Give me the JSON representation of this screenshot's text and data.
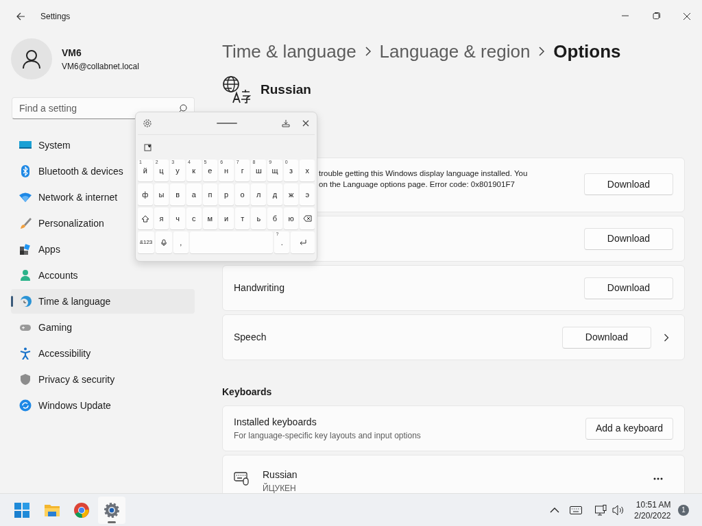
{
  "window": {
    "title": "Settings"
  },
  "user": {
    "name": "VM6",
    "email": "VM6@collabnet.local"
  },
  "search": {
    "placeholder": "Find a setting"
  },
  "sidebar": {
    "items": [
      {
        "label": "System",
        "selected": false
      },
      {
        "label": "Bluetooth & devices",
        "selected": false
      },
      {
        "label": "Network & internet",
        "selected": false
      },
      {
        "label": "Personalization",
        "selected": false
      },
      {
        "label": "Apps",
        "selected": false
      },
      {
        "label": "Accounts",
        "selected": false
      },
      {
        "label": "Time & language",
        "selected": true
      },
      {
        "label": "Gaming",
        "selected": false
      },
      {
        "label": "Accessibility",
        "selected": false
      },
      {
        "label": "Privacy & security",
        "selected": false
      },
      {
        "label": "Windows Update",
        "selected": false
      }
    ]
  },
  "breadcrumb": [
    {
      "label": "Time & language",
      "current": false
    },
    {
      "label": "Language & region",
      "current": false
    },
    {
      "label": "Options",
      "current": true
    }
  ],
  "language": {
    "name": "Russian"
  },
  "features": [
    {
      "kind": "error",
      "lines": [
        "trouble getting this Windows display language installed. You",
        "on the Language options page. Error code: 0x801901F7"
      ],
      "button": "Download"
    },
    {
      "kind": "covered",
      "button": "Download"
    },
    {
      "kind": "plain",
      "title": "Handwriting",
      "button": "Download"
    },
    {
      "kind": "plain",
      "title": "Speech",
      "button": "Download",
      "chevron": true
    }
  ],
  "keyboards": {
    "heading": "Keyboards",
    "installed": {
      "title": "Installed keyboards",
      "subtitle": "For language-specific key layouts and input options",
      "button": "Add a keyboard"
    },
    "items": [
      {
        "name": "Russian",
        "layout": "ЙЦУКЕН"
      }
    ]
  },
  "touch_keyboard": {
    "rows": [
      [
        {
          "kind": "char",
          "label": "й",
          "hint": "1"
        },
        {
          "kind": "char",
          "label": "ц",
          "hint": "2"
        },
        {
          "kind": "char",
          "label": "у",
          "hint": "3"
        },
        {
          "kind": "char",
          "label": "к",
          "hint": "4"
        },
        {
          "kind": "char",
          "label": "е",
          "hint": "5"
        },
        {
          "kind": "char",
          "label": "н",
          "hint": "6"
        },
        {
          "kind": "char",
          "label": "г",
          "hint": "7"
        },
        {
          "kind": "char",
          "label": "ш",
          "hint": "8"
        },
        {
          "kind": "char",
          "label": "щ",
          "hint": "9"
        },
        {
          "kind": "char",
          "label": "з",
          "hint": "0"
        },
        {
          "kind": "char",
          "label": "х"
        }
      ],
      [
        {
          "kind": "char",
          "label": "ф"
        },
        {
          "kind": "char",
          "label": "ы"
        },
        {
          "kind": "char",
          "label": "в"
        },
        {
          "kind": "char",
          "label": "а"
        },
        {
          "kind": "char",
          "label": "п"
        },
        {
          "kind": "char",
          "label": "р"
        },
        {
          "kind": "char",
          "label": "о"
        },
        {
          "kind": "char",
          "label": "л"
        },
        {
          "kind": "char",
          "label": "д"
        },
        {
          "kind": "char",
          "label": "ж"
        },
        {
          "kind": "char",
          "label": "э"
        }
      ],
      [
        {
          "kind": "shift"
        },
        {
          "kind": "char",
          "label": "я"
        },
        {
          "kind": "char",
          "label": "ч"
        },
        {
          "kind": "char",
          "label": "с"
        },
        {
          "kind": "char",
          "label": "м"
        },
        {
          "kind": "char",
          "label": "и"
        },
        {
          "kind": "char",
          "label": "т"
        },
        {
          "kind": "char",
          "label": "ь"
        },
        {
          "kind": "char",
          "label": "б"
        },
        {
          "kind": "char",
          "label": "ю"
        },
        {
          "kind": "backspace"
        }
      ],
      [
        {
          "kind": "symbols",
          "label": "&123"
        },
        {
          "kind": "mic"
        },
        {
          "kind": "char",
          "label": ","
        },
        {
          "kind": "space"
        },
        {
          "kind": "char",
          "label": ".",
          "hint": "?"
        },
        {
          "kind": "enter"
        }
      ]
    ]
  },
  "taskbar": {
    "apps": [
      {
        "selected": false
      },
      {
        "selected": false
      },
      {
        "selected": false
      },
      {
        "selected": true
      }
    ],
    "time": "10:51 AM",
    "date": "2/20/2022",
    "notifications": "1"
  }
}
